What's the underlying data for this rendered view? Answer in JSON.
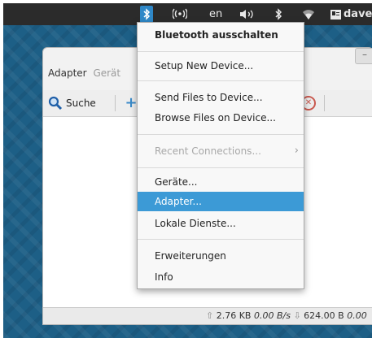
{
  "topbar": {
    "bluetooth_icon": "bluetooth-icon",
    "network_icon": "wifi-signal-icon",
    "keyboard_layout": "en",
    "volume_icon": "volume-icon",
    "bluetooth_icon_2": "bluetooth-icon",
    "wifi_icon": "wifi-icon",
    "user_icon": "user-icon",
    "user_name": "daver"
  },
  "window": {
    "tabs": [
      "Adapter",
      "Gerät"
    ],
    "toolbar": {
      "search_label": "Suche"
    },
    "status": {
      "up_bytes": "2.76 KB",
      "up_rate": "0.00 B/s",
      "down_bytes": "624.00 B",
      "down_rate": "0.00"
    }
  },
  "menu": {
    "items": [
      {
        "label": "Bluetooth ausschalten",
        "type": "header"
      },
      {
        "label": "Setup New Device...",
        "mnemonic": "S"
      },
      {
        "label": "Send Files to Device...",
        "mnemonic": "F"
      },
      {
        "label": "Browse Files on Device...",
        "mnemonic": "B"
      },
      {
        "label": "Recent Connections...",
        "state": "disabled",
        "submenu": true
      },
      {
        "label": "Geräte...",
        "mnemonic": "G"
      },
      {
        "label": "Adapter...",
        "state": "selected"
      },
      {
        "label": "Lokale Dienste...",
        "mnemonic": "L"
      },
      {
        "label": "Erweiterungen",
        "mnemonic": "E"
      },
      {
        "label": "Info",
        "mnemonic": "I"
      }
    ]
  },
  "colors": {
    "menu_highlight": "#3c9ad6",
    "topbar": "#2b2b2b",
    "desktop": "#1d5f86"
  }
}
